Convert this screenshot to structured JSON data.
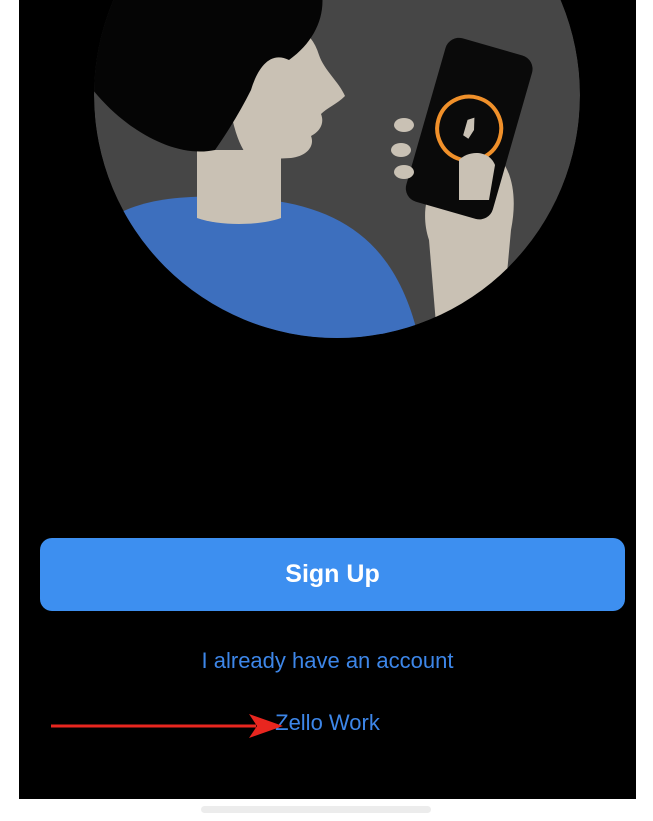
{
  "buttons": {
    "sign_up": "Sign Up"
  },
  "links": {
    "existing_account": "I already have an account",
    "zello_work": "Zello Work"
  },
  "colors": {
    "background": "#000000",
    "accent_blue": "#3d8ff0",
    "link_blue": "#3d86e8",
    "annotation_arrow": "#e8261f",
    "illustration_orange": "#f0902a"
  },
  "icons": {
    "hero": "person-using-phone-illustration",
    "annotation": "red-arrow-pointer"
  }
}
